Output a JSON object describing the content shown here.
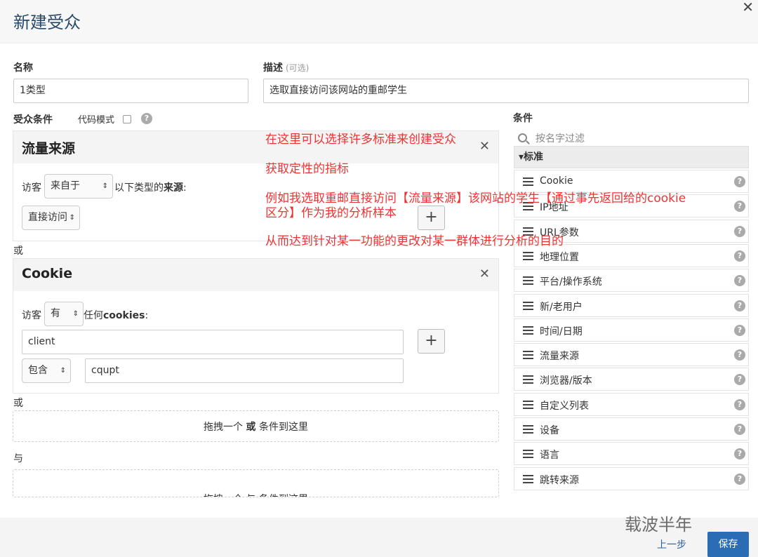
{
  "dialog": {
    "title": "新建受众"
  },
  "name": {
    "label": "名称",
    "value": "1类型"
  },
  "description": {
    "label": "描述",
    "optional": "(可选)",
    "value": "选取直接访问该网站的重邮学生"
  },
  "conditions": {
    "label": "受众条件",
    "code_mode_label": "代码模式",
    "panels": [
      {
        "title": "流量来源",
        "visitor_label": "访客",
        "operator": "来自于",
        "suffix_prefix": "以下类型的",
        "suffix_bold": "来源",
        "suffix_colon": ":",
        "source_value": "直接访问"
      },
      {
        "title": "Cookie",
        "visitor_label": "访客",
        "operator": "有",
        "suffix_prefix": "任何",
        "suffix_bold": "cookies",
        "suffix_colon": ":",
        "cookie_name": "client",
        "match_operator": "包含",
        "match_value": "cqupt"
      }
    ],
    "or_label": "或",
    "and_label": "与",
    "drop_text_prefix": "拖拽一个",
    "drop_text_bold": "或",
    "drop_text_suffix": "条件到这里",
    "drop_text_cut": "拖拽一个 与 条件到这里"
  },
  "annotations": [
    "在这里可以选择许多标准来创建受众",
    "获取定性的指标",
    "例如我选取重邮直接访问【流量来源】该网站的学生【通过事先返回给的cookie",
    "区分】作为我的分析样本",
    "从而达到针对某一功能的更改对某一群体进行分析的目的"
  ],
  "sidebar": {
    "title": "条件",
    "filter_placeholder": "按名字过滤",
    "group_label": "▾标准",
    "items": [
      "Cookie",
      "IP地址",
      "URL参数",
      "地理位置",
      "平台/操作系统",
      "新/老用户",
      "时间/日期",
      "流量来源",
      "浏览器/版本",
      "自定义列表",
      "设备",
      "语言",
      "跳转来源"
    ]
  },
  "footer": {
    "prev_label": "上一步",
    "save_label": "保存"
  },
  "watermark": "载波半年",
  "colors": {
    "primary": "#2a6db5",
    "annotation": "#e33333",
    "title": "#2a4a6a"
  }
}
